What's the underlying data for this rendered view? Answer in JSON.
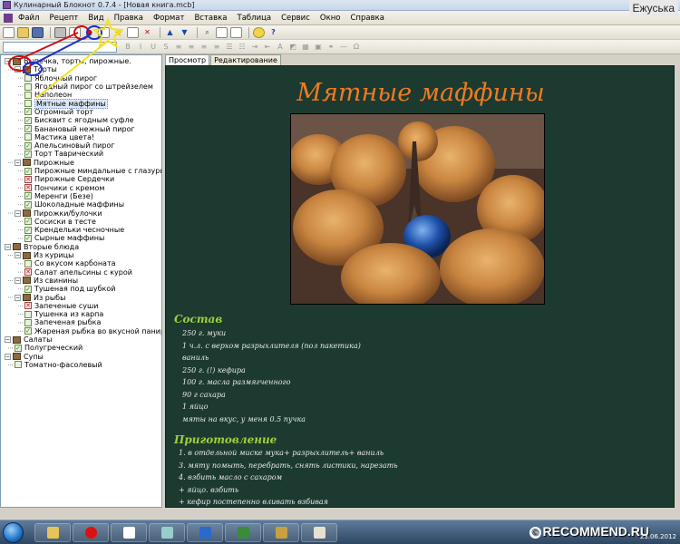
{
  "window": {
    "title": "Кулинарный Блокнот 0.7.4 - [Новая книга.mcb]",
    "corner_user": "Ежуська"
  },
  "menu": [
    "Файл",
    "Рецепт",
    "Вид",
    "Правка",
    "Формат",
    "Вставка",
    "Таблица",
    "Сервис",
    "Окно",
    "Справка"
  ],
  "tabs": {
    "view": "Просмотр",
    "edit": "Редактирование"
  },
  "tree": [
    {
      "label": "Выпечка, торты, пирожные.",
      "level": 0,
      "icon": "book",
      "expanded": true
    },
    {
      "label": "Торты",
      "level": 1,
      "icon": "book",
      "expanded": true
    },
    {
      "label": "Яблочный пирог",
      "level": 2,
      "icon": "none"
    },
    {
      "label": "Ягодный пирог со штрейзелем",
      "level": 2,
      "icon": "none"
    },
    {
      "label": "Наполеон",
      "level": 2,
      "icon": "none"
    },
    {
      "label": "Мятные маффины",
      "level": 2,
      "icon": "none",
      "selected": true
    },
    {
      "label": "Огромный торт",
      "level": 2,
      "icon": "ok"
    },
    {
      "label": "Бисквит с ягодным суфле",
      "level": 2,
      "icon": "ok"
    },
    {
      "label": "Банановый нежный пирог",
      "level": 2,
      "icon": "ok"
    },
    {
      "label": "Мастика цвета!",
      "level": 2,
      "icon": "none"
    },
    {
      "label": "Апельсиновый пирог",
      "level": 2,
      "icon": "ok"
    },
    {
      "label": "Торт Таврический",
      "level": 2,
      "icon": "ok"
    },
    {
      "label": "Пирожные",
      "level": 1,
      "icon": "book",
      "expanded": true
    },
    {
      "label": "Пирожные миндальные с глазурью",
      "level": 2,
      "icon": "ok"
    },
    {
      "label": "Пирожные Сердечки",
      "level": 2,
      "icon": "bad"
    },
    {
      "label": "Пончики с кремом",
      "level": 2,
      "icon": "bad"
    },
    {
      "label": "Меренги (Безе)",
      "level": 2,
      "icon": "ok"
    },
    {
      "label": "Шоколадные маффины",
      "level": 2,
      "icon": "ok"
    },
    {
      "label": "Пирожки/булочки",
      "level": 1,
      "icon": "book",
      "expanded": true
    },
    {
      "label": "Сосиски в тесте",
      "level": 2,
      "icon": "ok"
    },
    {
      "label": "Крендельки чесночные",
      "level": 2,
      "icon": "ok"
    },
    {
      "label": "Сырные маффины",
      "level": 2,
      "icon": "ok"
    },
    {
      "label": "Вторые блюда",
      "level": 0,
      "icon": "book",
      "expanded": true
    },
    {
      "label": "Из курицы",
      "level": 1,
      "icon": "book",
      "expanded": true
    },
    {
      "label": "Со вкусом карбоната",
      "level": 2,
      "icon": "none"
    },
    {
      "label": "Салат апельсины с курой",
      "level": 2,
      "icon": "bad"
    },
    {
      "label": "Из свинины",
      "level": 1,
      "icon": "book",
      "expanded": true
    },
    {
      "label": "Тушеная под шубкой",
      "level": 2,
      "icon": "ok"
    },
    {
      "label": "Из рыбы",
      "level": 1,
      "icon": "book",
      "expanded": true
    },
    {
      "label": "Запеченые суши",
      "level": 2,
      "icon": "bad"
    },
    {
      "label": "Тушенка из карпа",
      "level": 2,
      "icon": "none"
    },
    {
      "label": "Запеченая рыбка",
      "level": 2,
      "icon": "none"
    },
    {
      "label": "Жареная рыбка во вкусной панир",
      "level": 2,
      "icon": "ok"
    },
    {
      "label": "Салаты",
      "level": 0,
      "icon": "book",
      "expanded": true
    },
    {
      "label": "Полугреческий",
      "level": 1,
      "icon": "ok"
    },
    {
      "label": "Супы",
      "level": 0,
      "icon": "book",
      "expanded": true
    },
    {
      "label": "Томатно-фасолевый",
      "level": 1,
      "icon": "none"
    }
  ],
  "recipe": {
    "title": "Мятные маффины",
    "ingredients_head": "Состав",
    "ingredients": [
      "250 г. муки",
      "1 ч.л. с верхом разрыхлителя (пол пакетика)",
      "ваниль",
      "250 г. (!) кефира",
      "100 г. масла размягченного",
      "90 г сахара",
      "1 яйцо",
      "мяты на вкус, у меня 0.5 пучка"
    ],
    "steps_head": "Приготовление",
    "steps": [
      "1. в отдельной миске мука+ разрыхлитель+ ваниль",
      "3. мяту помыть, перебрать, снять листики, нарезать",
      "4. взбить масло с сахаром",
      "+ яйцо. взбить",
      "+ кефир постепенно вливать взбивая"
    ]
  },
  "taskbar": {
    "watermark": "RECOMMEND.RU",
    "date": "23.06.2012"
  },
  "colors": {
    "content_bg": "#1c3a2f",
    "title": "#f07a22",
    "section": "#9fd13c",
    "text": "#e9e9e9"
  }
}
